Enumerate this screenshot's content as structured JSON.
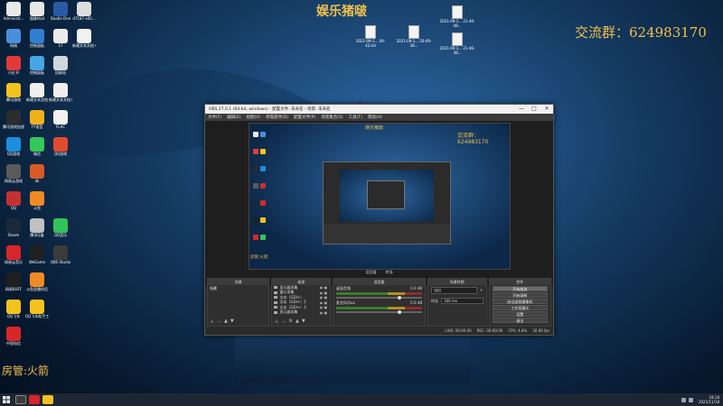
{
  "desktop": {
    "title_cn": "娱乐猪啵",
    "group_text": "交流群：624983170",
    "room_admin": "房管:火箭",
    "icons": [
      {
        "label": "Administr...",
        "color": "#e8e8e8"
      },
      {
        "label": "图像ttod",
        "color": "#e6e6e6"
      },
      {
        "label": "Studio One",
        "color": "#2a5aa6"
      },
      {
        "label": "d7187 e05...",
        "color": "#dddddd"
      },
      {
        "label": "网络",
        "color": "#4a8fdc"
      },
      {
        "label": "控制面板",
        "color": "#2f7fd1"
      },
      {
        "label": "17",
        "color": "#ececec"
      },
      {
        "label": "新建文本文档 (2).txt",
        "color": "#f2f2f2"
      },
      {
        "label": "小红书",
        "color": "#e23a3a"
      },
      {
        "label": "控制面板",
        "color": "#48a5e4"
      },
      {
        "label": "回收站",
        "color": "#cfd7de"
      },
      {
        "label": "",
        "color": ""
      },
      {
        "label": "腾讯游戏",
        "color": "#f4c21e"
      },
      {
        "label": "新建文本文档",
        "color": "#f0f0f0"
      },
      {
        "label": "新建文本文档.txt",
        "color": "#f0f0f0"
      },
      {
        "label": "",
        "color": ""
      },
      {
        "label": "腾讯游戏加速",
        "color": "#2c2c2c"
      },
      {
        "label": "YY语音",
        "color": "#f0b21b"
      },
      {
        "label": "FLAC",
        "color": "#f2f2f2"
      },
      {
        "label": "",
        "color": ""
      },
      {
        "label": "QQ游戏",
        "color": "#1b8ee0"
      },
      {
        "label": "微信",
        "color": "#34c759"
      },
      {
        "label": "QQ游戏",
        "color": "#e14b2e"
      },
      {
        "label": "",
        "color": ""
      },
      {
        "label": "网易云游戏",
        "color": "#5a5a5a"
      },
      {
        "label": "4k",
        "color": "#d85a24"
      },
      {
        "label": "",
        "color": ""
      },
      {
        "label": "",
        "color": ""
      },
      {
        "label": "QQ",
        "color": "#c53030"
      },
      {
        "label": "斗鱼",
        "color": "#f08a24"
      },
      {
        "label": "",
        "color": ""
      },
      {
        "label": "",
        "color": ""
      },
      {
        "label": "Steam",
        "color": "#1a2a3c"
      },
      {
        "label": "腾讯Q盒",
        "color": "#c0c0c0"
      },
      {
        "label": "QQ音乐",
        "color": "#32c45a"
      },
      {
        "label": "",
        "color": ""
      },
      {
        "label": "网易云音乐",
        "color": "#d8262a"
      },
      {
        "label": "WeGame",
        "color": "#202020"
      },
      {
        "label": "OBS Studio",
        "color": "#3b3b3b"
      },
      {
        "label": "",
        "color": ""
      },
      {
        "label": "网易BUFF",
        "color": "#1f1f1f"
      },
      {
        "label": "斗鱼直播伴侣",
        "color": "#f08a24"
      },
      {
        "label": "",
        "color": ""
      },
      {
        "label": "",
        "color": ""
      },
      {
        "label": "QQ飞车",
        "color": "#f4c21e"
      },
      {
        "label": "QQ飞车助手工具",
        "color": "#f4c21e"
      },
      {
        "label": "",
        "color": ""
      },
      {
        "label": "",
        "color": ""
      },
      {
        "label": "中国电信",
        "color": "#d8262a"
      }
    ],
    "files": [
      {
        "label": "2021-09-1... 09-42.txt"
      },
      {
        "label": "2021-09-1... 20-09-38..."
      },
      {
        "label": "2021-09-1... 21-46-48..."
      },
      {
        "label": "2021-09-1... 21-46-48..."
      }
    ]
  },
  "obs": {
    "title": "OBS 27.0.1 (64-bit, windows) - 配置文件: 未命名 - 场景: 未命名",
    "menu": [
      "文件(F)",
      "编辑(E)",
      "视图(V)",
      "停靠部件(D)",
      "配置文件(P)",
      "场景集合(S)",
      "工具(T)",
      "帮助(H)"
    ],
    "preview_title": "娱乐猪啵",
    "preview_group": "交流群：624983170",
    "preview_room": "房管:火箭",
    "preview_tabs": [
      "混音器",
      "转场"
    ],
    "docks": {
      "scenes": {
        "header": "场景",
        "items": [
          "场景"
        ]
      },
      "sources": {
        "header": "来源",
        "items": [
          "显示器采集",
          "窗口采集",
          "文本（GDI+）",
          "文本（GDI+）2",
          "文本（GDI+）3",
          "显示器采集"
        ]
      },
      "mixer": {
        "header": "混音器",
        "tracks": [
          {
            "name": "桌面音频",
            "level": "0.0 dB",
            "volume": 0.72
          },
          {
            "name": "麦克风/Aux",
            "level": "0.0 dB",
            "volume": 0.72
          }
        ]
      },
      "transitions": {
        "header": "场景转换",
        "type": "淡出",
        "duration_label": "时长",
        "duration": "300 ms"
      },
      "controls": {
        "header": "控件",
        "buttons": [
          "开始推流",
          "开始录制",
          "启动虚拟摄像机",
          "工作室模式",
          "设置",
          "退出"
        ]
      }
    },
    "status": {
      "live": "LIVE: 00:00:00",
      "rec": "REC: 00:00:00",
      "cpu": "CPU: 4.6%",
      "fps": "30.00 fps"
    }
  },
  "taskbar": {
    "apps": [
      {
        "name": "start",
        "color": "#ffffff"
      },
      {
        "name": "obs",
        "color": "#3b3b3b"
      },
      {
        "name": "netease",
        "color": "#d8262a"
      },
      {
        "name": "folder",
        "color": "#f4c21e"
      }
    ],
    "time": "18:18",
    "date": "2021/11/18"
  }
}
